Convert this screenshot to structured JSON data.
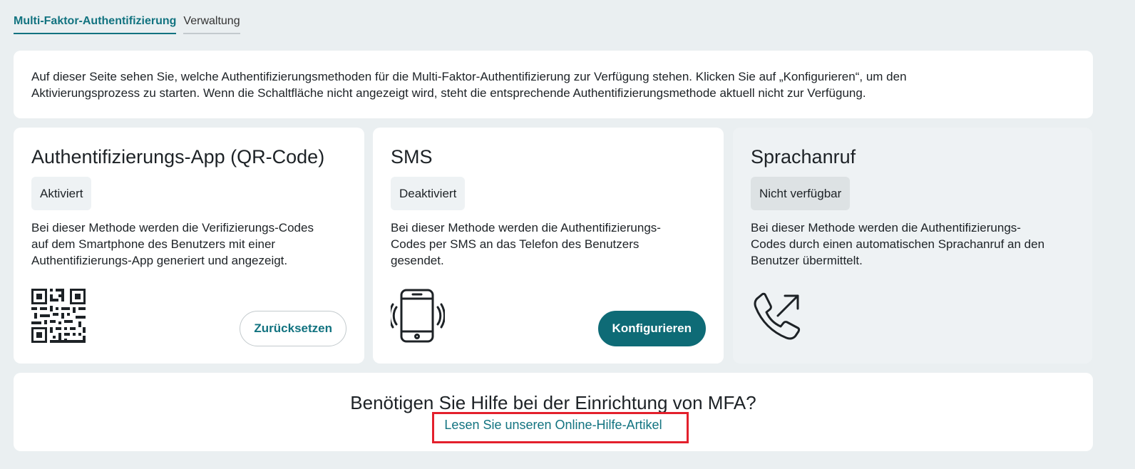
{
  "tabs": [
    {
      "label": "Multi-Faktor-Authentifizierung",
      "active": true
    },
    {
      "label": "Verwaltung",
      "active": false
    }
  ],
  "intro": {
    "line1": "Auf dieser Seite sehen Sie, welche Authentifizierungsmethoden für die Multi-Faktor-Authentifizierung zur Verfügung stehen. Klicken Sie auf „Konfigurieren“, um den",
    "line2": "Aktivierungsprozess zu starten. Wenn die Schaltfläche nicht angezeigt wird, steht die entsprechende Authentifizierungsmethode aktuell nicht zur Verfügung."
  },
  "methods": [
    {
      "title": "Authentifizierungs-App (QR-Code)",
      "status": "Aktiviert",
      "desc_lines": [
        "Bei dieser Methode werden die Verifizierungs-Codes",
        "auf dem Smartphone des Benutzers mit einer",
        "Authentifizierungs-App generiert und angezeigt."
      ],
      "icon": "qr-code-icon",
      "button": "Zurücksetzen"
    },
    {
      "title": "SMS",
      "status": "Deaktiviert",
      "desc_lines": [
        "Bei dieser Methode werden die Authentifizierungs-",
        "Codes per SMS an das Telefon des Benutzers",
        "gesendet."
      ],
      "icon": "smartphone-vibrate-icon",
      "button": "Konfigurieren"
    },
    {
      "title": "Sprachanruf",
      "status": "Nicht verfügbar",
      "desc_lines": [
        "Bei dieser Methode werden die Authentifizierungs-",
        "Codes durch einen automatischen Sprachanruf an den",
        "Benutzer übermittelt."
      ],
      "icon": "phone-outgoing-icon"
    }
  ],
  "help": {
    "title": "Benötigen Sie Hilfe bei der Einrichtung von MFA?",
    "link": "Lesen Sie unseren Online-Hilfe-Artikel"
  },
  "colors": {
    "accent": "#127380",
    "button_fill": "#0e6b76",
    "background": "#eaeff1",
    "highlight_border": "#e3202c"
  }
}
